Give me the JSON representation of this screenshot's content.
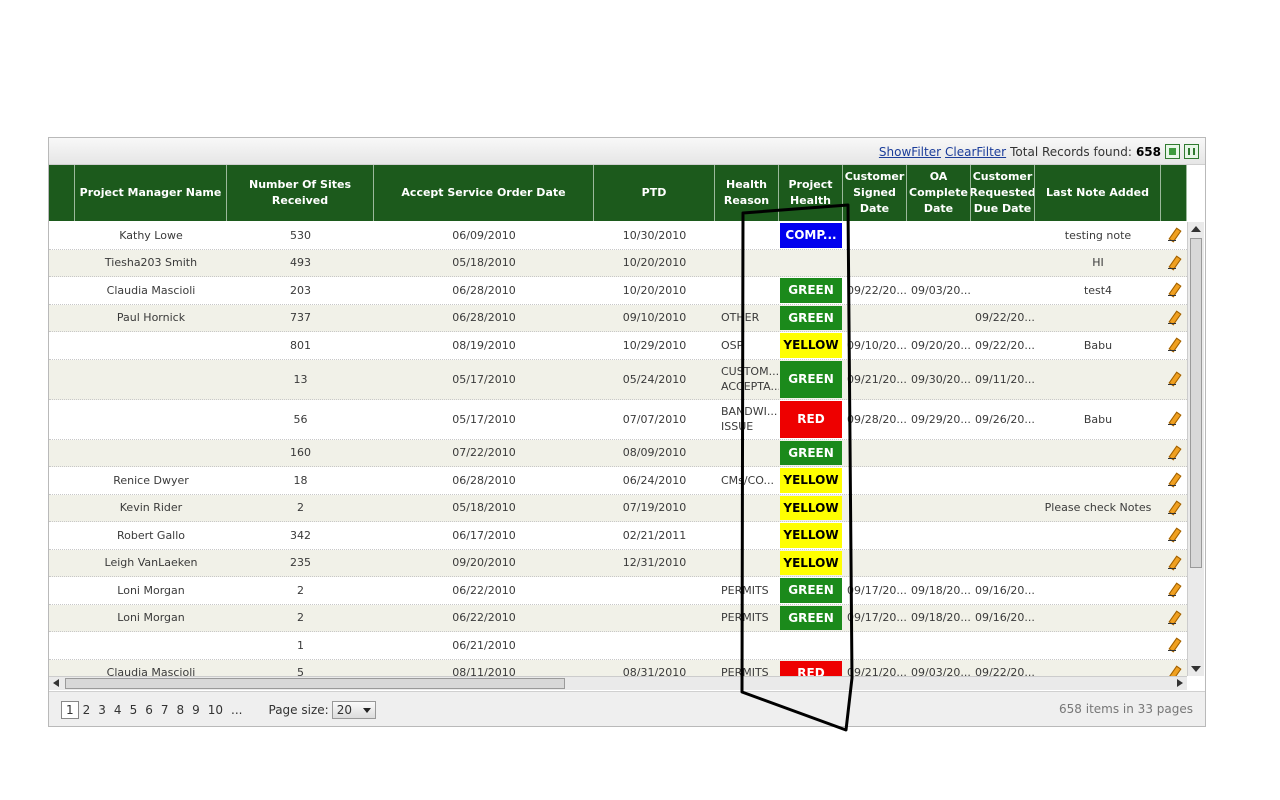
{
  "toolbar": {
    "show_filter": "ShowFilter",
    "clear_filter": "ClearFilter",
    "total_label": "Total Records found:",
    "total_count": "658",
    "export_icons": [
      "excel-export-icon",
      "excel-export-all-icon"
    ]
  },
  "columns": [
    {
      "key": "sel",
      "label": ""
    },
    {
      "key": "pm",
      "label": "Project Manager Name"
    },
    {
      "key": "sites",
      "label": "Number Of Sites Received"
    },
    {
      "key": "accept",
      "label": "Accept Service Order Date"
    },
    {
      "key": "ptd",
      "label": "PTD"
    },
    {
      "key": "reason",
      "label": "Health Reason"
    },
    {
      "key": "health",
      "label": "Project Health"
    },
    {
      "key": "signed",
      "label": "Customer Signed Date"
    },
    {
      "key": "oa",
      "label": "OA Complete Date"
    },
    {
      "key": "due",
      "label": "Customer Requested Due Date"
    },
    {
      "key": "note",
      "label": "Last Note Added"
    },
    {
      "key": "edit",
      "label": ""
    }
  ],
  "health_colors": {
    "COMP...": {
      "bg": "#0000ee",
      "fg": "#ffffff"
    },
    "GREEN": {
      "bg": "#1b8a1b",
      "fg": "#ffffff"
    },
    "YELLOW": {
      "bg": "#ffff00",
      "fg": "#000000"
    },
    "RED": {
      "bg": "#ee0000",
      "fg": "#ffffff"
    }
  },
  "rows": [
    {
      "pm": "Kathy Lowe",
      "sites": "530",
      "accept": "06/09/2010",
      "ptd": "10/30/2010",
      "reason": "",
      "health": "COMP...",
      "signed": "",
      "oa": "",
      "due": "",
      "note": "testing note"
    },
    {
      "pm": "Tiesha203 Smith",
      "sites": "493",
      "accept": "05/18/2010",
      "ptd": "10/20/2010",
      "reason": "",
      "health": "",
      "signed": "",
      "oa": "",
      "due": "",
      "note": "HI"
    },
    {
      "pm": "Claudia Mascioli",
      "sites": "203",
      "accept": "06/28/2010",
      "ptd": "10/20/2010",
      "reason": "",
      "health": "GREEN",
      "signed": "09/22/20...",
      "oa": "09/03/20...",
      "due": "",
      "note": "test4"
    },
    {
      "pm": "Paul Hornick",
      "sites": "737",
      "accept": "06/28/2010",
      "ptd": "09/10/2010",
      "reason": "OTHER",
      "health": "GREEN",
      "signed": "",
      "oa": "",
      "due": "09/22/20...",
      "note": ""
    },
    {
      "pm": "",
      "sites": "801",
      "accept": "08/19/2010",
      "ptd": "10/29/2010",
      "reason": "OSP",
      "health": "YELLOW",
      "signed": "09/10/20...",
      "oa": "09/20/20...",
      "due": "09/22/20...",
      "note": "Babu"
    },
    {
      "pm": "",
      "sites": "13",
      "accept": "05/17/2010",
      "ptd": "05/24/2010",
      "reason": "CUSTOM... ACCEPTA...",
      "health": "GREEN",
      "signed": "09/21/20...",
      "oa": "09/30/20...",
      "due": "09/11/20...",
      "note": "",
      "tall": 40
    },
    {
      "pm": "",
      "sites": "56",
      "accept": "05/17/2010",
      "ptd": "07/07/2010",
      "reason": "BANDWI... ISSUE",
      "health": "RED",
      "signed": "09/28/20...",
      "oa": "09/29/20...",
      "due": "09/26/20...",
      "note": "Babu",
      "tall": 40
    },
    {
      "pm": "",
      "sites": "160",
      "accept": "07/22/2010",
      "ptd": "08/09/2010",
      "reason": "",
      "health": "GREEN",
      "signed": "",
      "oa": "",
      "due": "",
      "note": ""
    },
    {
      "pm": "Renice Dwyer",
      "sites": "18",
      "accept": "06/28/2010",
      "ptd": "06/24/2010",
      "reason": "CMs/CO...",
      "health": "YELLOW",
      "signed": "",
      "oa": "",
      "due": "",
      "note": ""
    },
    {
      "pm": "Kevin Rider",
      "sites": "2",
      "accept": "05/18/2010",
      "ptd": "07/19/2010",
      "reason": "",
      "health": "YELLOW",
      "signed": "",
      "oa": "",
      "due": "",
      "note": "Please check Notes"
    },
    {
      "pm": "Robert Gallo",
      "sites": "342",
      "accept": "06/17/2010",
      "ptd": "02/21/2011",
      "reason": "",
      "health": "YELLOW",
      "signed": "",
      "oa": "",
      "due": "",
      "note": ""
    },
    {
      "pm": "Leigh VanLaeken",
      "sites": "235",
      "accept": "09/20/2010",
      "ptd": "12/31/2010",
      "reason": "",
      "health": "YELLOW",
      "signed": "",
      "oa": "",
      "due": "",
      "note": ""
    },
    {
      "pm": "Loni Morgan",
      "sites": "2",
      "accept": "06/22/2010",
      "ptd": "",
      "reason": "PERMITS",
      "health": "GREEN",
      "signed": "09/17/20...",
      "oa": "09/18/20...",
      "due": "09/16/20...",
      "note": ""
    },
    {
      "pm": "Loni Morgan",
      "sites": "2",
      "accept": "06/22/2010",
      "ptd": "",
      "reason": "PERMITS",
      "health": "GREEN",
      "signed": "09/17/20...",
      "oa": "09/18/20...",
      "due": "09/16/20...",
      "note": ""
    },
    {
      "pm": "",
      "sites": "1",
      "accept": "06/21/2010",
      "ptd": "",
      "reason": "",
      "health": "",
      "signed": "",
      "oa": "",
      "due": "",
      "note": ""
    },
    {
      "pm": "Claudia Mascioli",
      "sites": "5",
      "accept": "08/11/2010",
      "ptd": "08/31/2010",
      "reason": "PERMITS",
      "health": "RED",
      "signed": "09/21/20...",
      "oa": "09/03/20...",
      "due": "09/22/20...",
      "note": ""
    }
  ],
  "pager": {
    "pages": [
      "1",
      "2",
      "3",
      "4",
      "5",
      "6",
      "7",
      "8",
      "9",
      "10",
      "..."
    ],
    "current_page": "1",
    "page_size_label": "Page size:",
    "page_size": "20",
    "summary": "658 items in 33 pages"
  }
}
